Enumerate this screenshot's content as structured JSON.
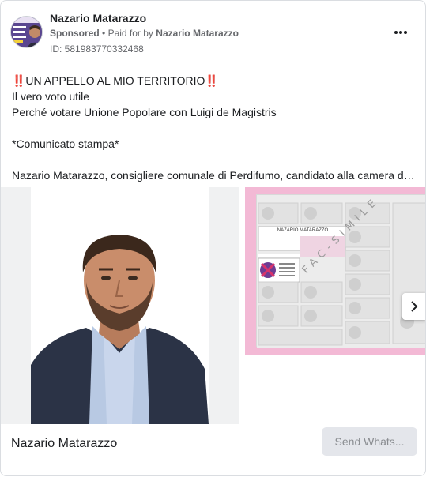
{
  "header": {
    "page_name": "Nazario Matarazzo",
    "sponsored_label": "Sponsored",
    "separator": "•",
    "paid_for_prefix": "Paid for by",
    "paid_for_name": "Nazario Matarazzo",
    "ad_id": "ID: 581983770332468"
  },
  "body": {
    "lines": [
      "‼️UN APPELLO AL MIO TERRITORIO‼️",
      "Il vero voto utile",
      "Perché votare Unione Popolare con Luigi de Magistris",
      "",
      "*Comunicato stampa*",
      "",
      "Nazario Matarazzo, consigliere comunale di Perdifumo, candidato alla camera de..."
    ]
  },
  "carousel": {
    "ballot_header": "NAZARIO MATARAZZO",
    "watermark": "FAC-SIMILE",
    "next_icon": "chevron-right-icon"
  },
  "footer": {
    "title": "Nazario Matarazzo",
    "cta_label": "Send Whats..."
  },
  "colors": {
    "cta_bg": "#e4e6eb",
    "ballot_border": "#f3b9d5",
    "avatar_bg": "#4a3a7a"
  }
}
